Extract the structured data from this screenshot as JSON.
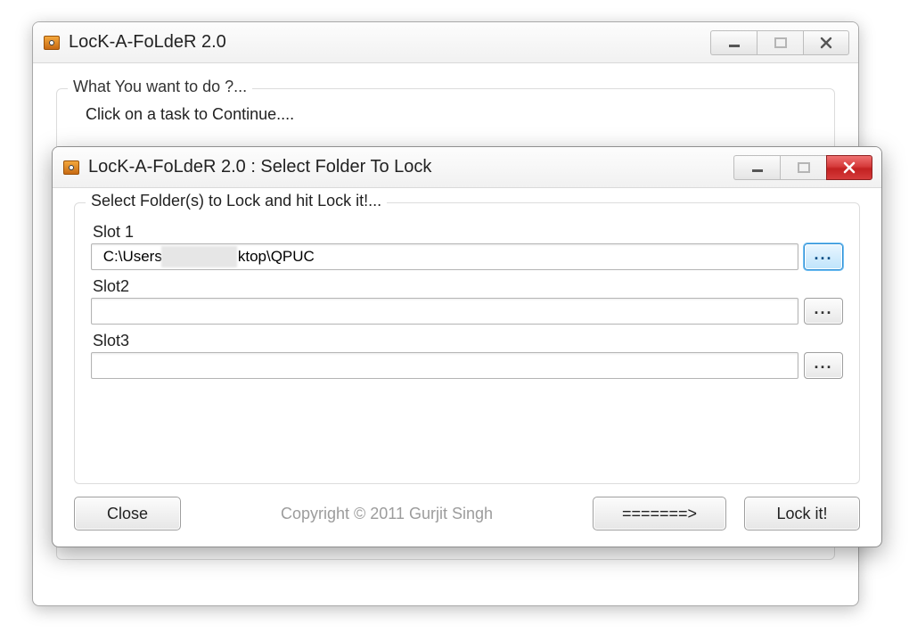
{
  "parent_window": {
    "title": "LocK-A-FoLdeR 2.0",
    "group_legend": "What You want to do ?...",
    "group_subtext": "Click on a task to Continue...."
  },
  "dialog": {
    "title": "LocK-A-FoLdeR 2.0 : Select Folder To Lock",
    "group_legend": "Select Folder(s) to Lock and hit Lock it!...",
    "slots": [
      {
        "label": "Slot 1",
        "value_prefix": "C:\\Users",
        "value_suffix": "ktop\\QPUC",
        "highlighted": true
      },
      {
        "label": "Slot2",
        "value": "",
        "highlighted": false
      },
      {
        "label": "Slot3",
        "value": "",
        "highlighted": false
      }
    ],
    "buttons": {
      "close": "Close",
      "arrow": "=======>",
      "lock": "Lock it!"
    },
    "copyright": "Copyright © 2011 Gurjit Singh"
  },
  "icons": {
    "browse_dots": "..."
  }
}
